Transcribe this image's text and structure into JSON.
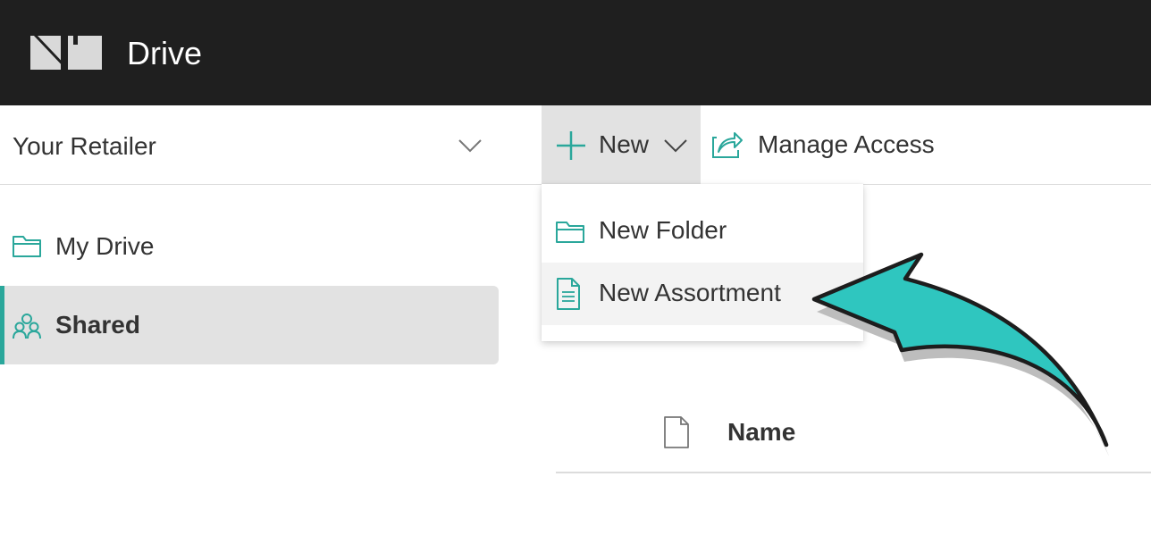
{
  "app": {
    "title": "Drive",
    "logo": "nu-logo"
  },
  "workspace": {
    "selected": "Your Retailer",
    "chevron_icon": "chevron-down-icon"
  },
  "toolbar": {
    "new_label": "New",
    "new_icon": "plus-icon",
    "new_chevron_icon": "chevron-down-icon",
    "manage_label": "Manage Access",
    "manage_icon": "share-icon"
  },
  "sidebar": {
    "items": [
      {
        "label": "My Drive",
        "icon": "folder-icon",
        "active": false
      },
      {
        "label": "Shared",
        "icon": "people-icon",
        "active": true
      }
    ]
  },
  "new_menu": {
    "items": [
      {
        "label": "New Folder",
        "icon": "folder-icon"
      },
      {
        "label": "New Assortment",
        "icon": "document-icon",
        "highlighted": true
      }
    ]
  },
  "file_list": {
    "columns": [
      {
        "icon": "file-icon"
      },
      {
        "label": "Name"
      }
    ]
  },
  "annotation": {
    "type": "arrow",
    "points_to": "New Assortment"
  },
  "colors": {
    "header_bg": "#1f1f1f",
    "accent": "#2aa79b",
    "arrow_fill": "#2fc6bf",
    "active_bg": "#e2e2e2"
  }
}
